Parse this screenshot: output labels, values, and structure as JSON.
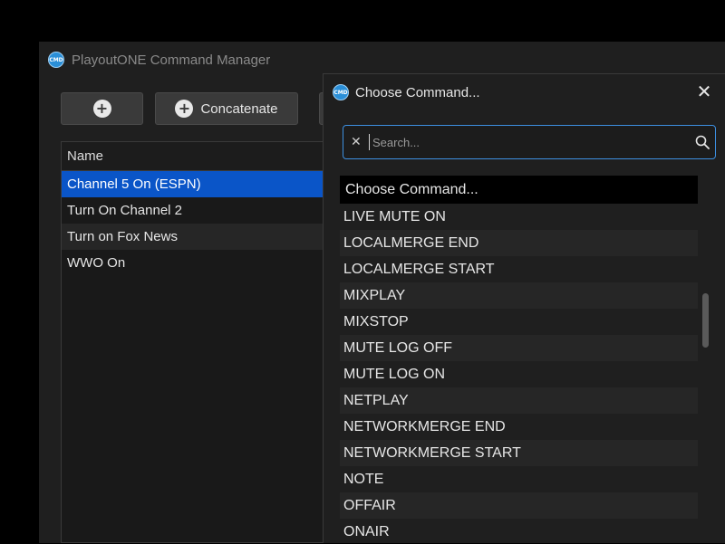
{
  "main": {
    "title": "PlayoutONE Command Manager",
    "badge": "CMD",
    "buttons": {
      "concatenate_label": "Concatenate"
    },
    "table": {
      "header": "Name",
      "rows": [
        "Channel 5 On (ESPN)",
        "Turn On Channel 2",
        "Turn on Fox News",
        "WWO On"
      ]
    }
  },
  "dialog": {
    "title": "Choose Command...",
    "badge": "CMD",
    "search": {
      "placeholder": "Search...",
      "value": ""
    },
    "list": {
      "selected": "Choose Command...",
      "items": [
        "LIVE MUTE ON",
        "LOCALMERGE END",
        "LOCALMERGE START",
        "MIXPLAY",
        "MIXSTOP",
        "MUTE LOG OFF",
        "MUTE LOG ON",
        "NETPLAY",
        "NETWORKMERGE END",
        "NETWORKMERGE START",
        "NOTE",
        "OFFAIR",
        "ONAIR"
      ]
    }
  },
  "icons": {
    "plus": "+",
    "close": "✕",
    "clear": "✕"
  }
}
